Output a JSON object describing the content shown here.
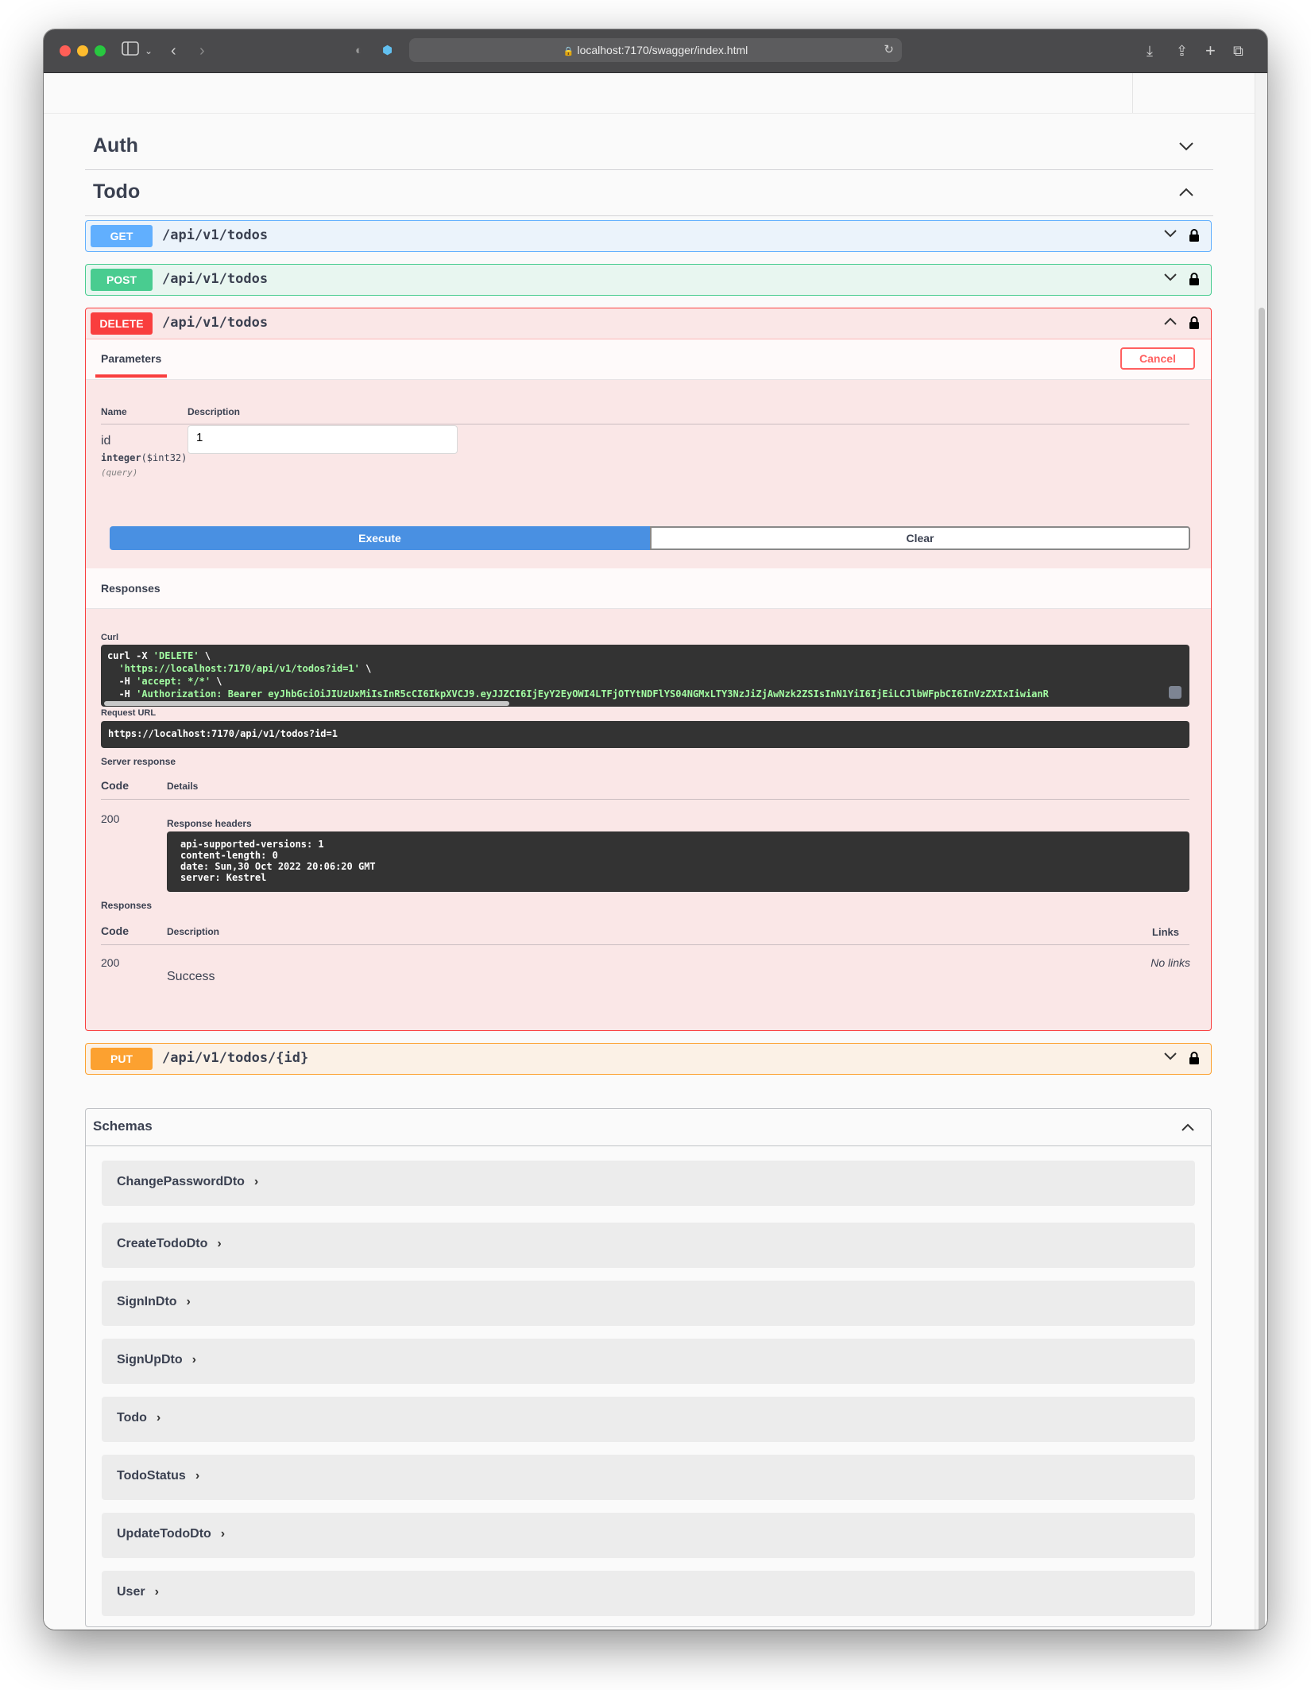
{
  "browser": {
    "url": "localhost:7170/swagger/index.html"
  },
  "tags": {
    "auth": "Auth",
    "todo": "Todo"
  },
  "operations": {
    "get": {
      "method": "GET",
      "path": "/api/v1/todos"
    },
    "post": {
      "method": "POST",
      "path": "/api/v1/todos"
    },
    "delete": {
      "method": "DELETE",
      "path": "/api/v1/todos"
    },
    "put": {
      "method": "PUT",
      "path": "/api/v1/todos/{id}"
    }
  },
  "delete_panel": {
    "tab_parameters": "Parameters",
    "cancel_label": "Cancel",
    "col_name": "Name",
    "col_description": "Description",
    "param": {
      "name": "id",
      "type": "integer",
      "format": "($int32)",
      "location": "(query)",
      "value": "1"
    },
    "execute_label": "Execute",
    "clear_label": "Clear",
    "responses_title": "Responses",
    "curl_label": "Curl",
    "curl": {
      "line1_cmd": "curl -X ",
      "line1_method": "'DELETE'",
      "line1_end": " \\",
      "line2": "  'https://localhost:7170/api/v1/todos?id=1'",
      "line2_end": " \\",
      "line3_flag": "  -H ",
      "line3_val": "'accept: */*'",
      "line3_end": " \\",
      "line4_flag": "  -H ",
      "line4_val": "'Authorization: Bearer eyJhbGciOiJIUzUxMiIsInR5cCI6IkpXVCJ9.eyJJZCI6IjEyY2EyOWI4LTFjOTYtNDFlYS04NGMxLTY3NzJiZjAwNzk2ZSIsInN1YiI6IjEiLCJlbWFpbCI6InVzZXIxIiwianR"
    },
    "request_url_label": "Request URL",
    "request_url": "https://localhost:7170/api/v1/todos?id=1",
    "server_response_label": "Server response",
    "col_code": "Code",
    "col_details": "Details",
    "server_code": "200",
    "response_headers_label": "Response headers",
    "headers": [
      "api-supported-versions: 1",
      "content-length: 0",
      "date: Sun,30 Oct 2022 20:06:20 GMT",
      "server: Kestrel"
    ],
    "responses_label": "Responses",
    "resp_col_code": "Code",
    "resp_col_description": "Description",
    "resp_col_links": "Links",
    "resp_code": "200",
    "resp_description": "Success",
    "resp_links": "No links"
  },
  "schemas": {
    "title": "Schemas",
    "models": [
      "ChangePasswordDto",
      "CreateTodoDto",
      "SignInDto",
      "SignUpDto",
      "Todo",
      "TodoStatus",
      "UpdateTodoDto",
      "User"
    ]
  },
  "icons": {
    "lock": "lock-icon",
    "chevron": "chevron-icon"
  },
  "colors": {
    "get": "#61affe",
    "post": "#49cc90",
    "delete": "#f93e3e",
    "put": "#fca130"
  }
}
